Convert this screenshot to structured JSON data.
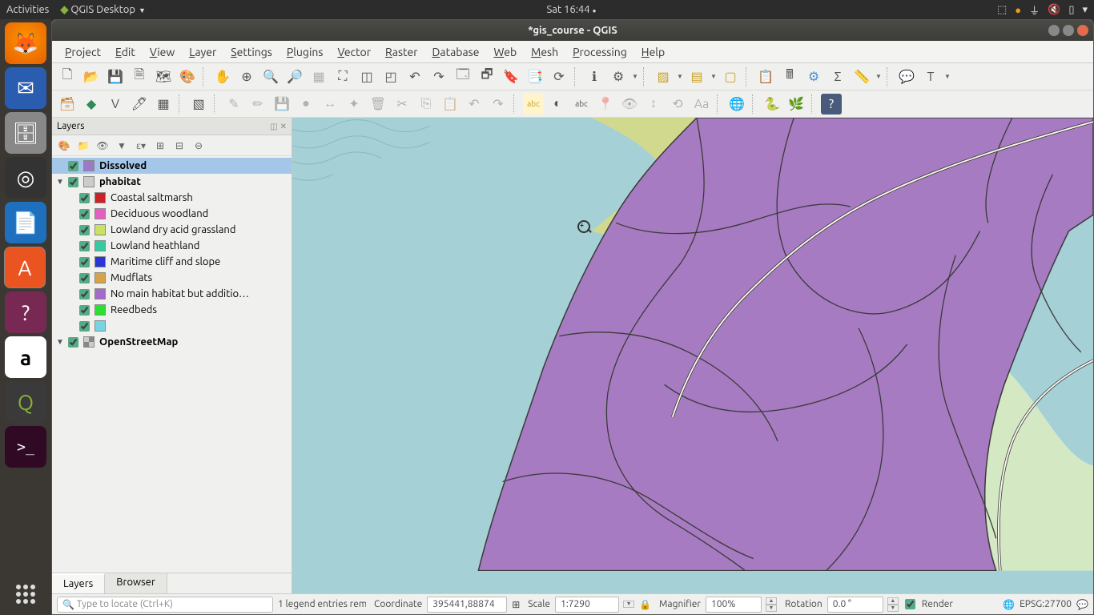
{
  "panel": {
    "activities": "Activities",
    "app": "QGIS Desktop",
    "clock": "Sat 16:44"
  },
  "window": {
    "title": "*gis_course - QGIS"
  },
  "menus": [
    "Project",
    "Edit",
    "View",
    "Layer",
    "Settings",
    "Plugins",
    "Vector",
    "Raster",
    "Database",
    "Web",
    "Mesh",
    "Processing",
    "Help"
  ],
  "layers_panel": {
    "title": "Layers",
    "tabs": {
      "layers": "Layers",
      "browser": "Browser"
    }
  },
  "layers": [
    {
      "name": "Dissolved",
      "color": "#9a7bc7",
      "selected": true,
      "expand": null,
      "bold": true,
      "indent": 0
    },
    {
      "name": "phabitat",
      "expand": "▼",
      "bold": true,
      "indent": 0,
      "icon": "poly"
    },
    {
      "name": "Coastal saltmarsh",
      "color": "#cb2128",
      "indent": 2
    },
    {
      "name": "Deciduous woodland",
      "color": "#e45fbf",
      "indent": 2
    },
    {
      "name": "Lowland dry acid grassland",
      "color": "#c9e265",
      "indent": 2
    },
    {
      "name": "Lowland heathland",
      "color": "#35cba0",
      "indent": 2
    },
    {
      "name": "Maritime cliff and slope",
      "color": "#2a35d6",
      "indent": 2
    },
    {
      "name": "Mudflats",
      "color": "#d6a24c",
      "indent": 2
    },
    {
      "name": "No main habitat but additio…",
      "color": "#a569c9",
      "indent": 2
    },
    {
      "name": "Reedbeds",
      "color": "#28e22f",
      "indent": 2
    },
    {
      "name": "",
      "color": "#76d5e3",
      "indent": 2
    },
    {
      "name": "OpenStreetMap",
      "expand": "▼",
      "bold": true,
      "indent": 0,
      "icon": "raster"
    }
  ],
  "status": {
    "locator_ph": "Type to locate (Ctrl+K)",
    "legend": "1 legend entries rem",
    "coord_lbl": "Coordinate",
    "coord": "395441,88874",
    "scale_lbl": "Scale",
    "scale": "1:7290",
    "mag_lbl": "Magnifier",
    "mag": "100%",
    "rot_lbl": "Rotation",
    "rot": "0.0 °",
    "render": "Render",
    "crs": "EPSG:27700"
  },
  "colors": {
    "water": "#a4d0d6",
    "sand": "#d1d98f",
    "purple": "#a77bc1",
    "green": "#d4e8c4",
    "road": "#f8f5ed",
    "outline": "#3a3a3a"
  }
}
